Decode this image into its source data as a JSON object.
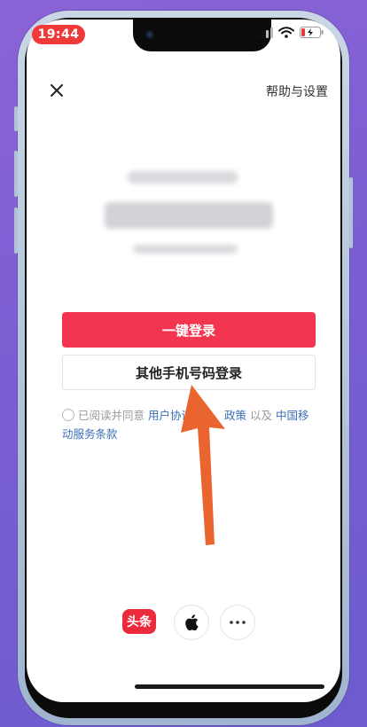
{
  "status_bar": {
    "time": "19:44"
  },
  "header": {
    "help_label": "帮助与设置"
  },
  "login": {
    "one_click_label": "一键登录",
    "other_phone_label": "其他手机号码登录"
  },
  "agreement": {
    "prefix": "已阅读并同意 ",
    "link1": "用户协议",
    "middle_visible": "政策",
    "and": " 以及 ",
    "link3": "中国移动服务条款"
  },
  "third_party": {
    "toutiao_label": "头条"
  },
  "colors": {
    "primary": "#f4354f",
    "link": "#3a6fb6",
    "arrow": "#e9642f"
  }
}
